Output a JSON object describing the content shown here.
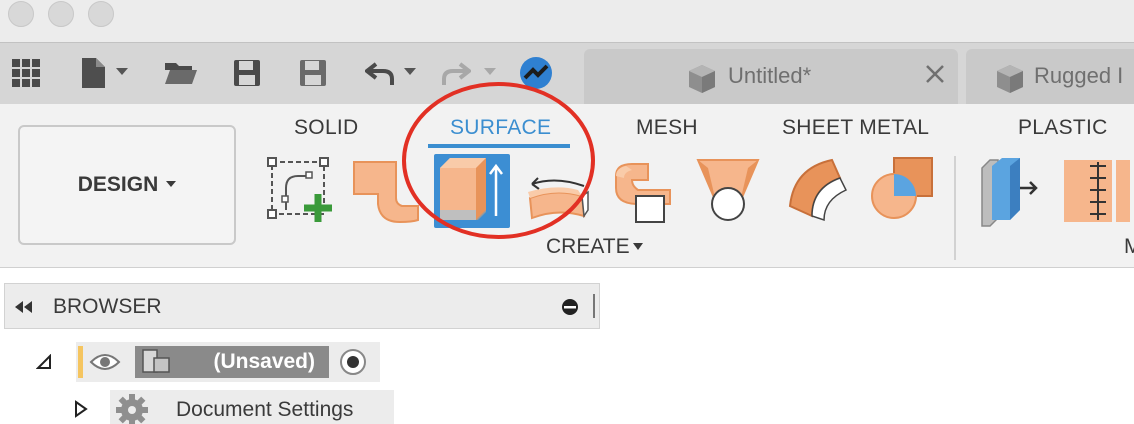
{
  "quick_access": {
    "icons": [
      "grid-icon",
      "file-icon",
      "open-folder-icon",
      "save-icon",
      "save-as-icon",
      "undo-icon",
      "redo-icon",
      "job-status-icon"
    ]
  },
  "document_tabs": [
    {
      "label": "Untitled*",
      "icon": "cube-icon"
    },
    {
      "label": "Rugged I",
      "icon": "cube-icon"
    }
  ],
  "ribbon": {
    "workspace_label": "DESIGN",
    "tabs": [
      {
        "label": "SOLID",
        "active": false
      },
      {
        "label": "SURFACE",
        "active": true
      },
      {
        "label": "MESH",
        "active": false
      },
      {
        "label": "SHEET METAL",
        "active": false
      },
      {
        "label": "PLASTIC",
        "active": false
      }
    ],
    "group_label": "CREATE",
    "next_group_label": "M",
    "tools": [
      "create-sketch-icon",
      "patch-icon",
      "extrude-icon",
      "revolve-icon",
      "sweep-icon",
      "loft-icon",
      "ruled-icon",
      "offset-icon",
      "thicken-icon",
      "split-body-icon"
    ]
  },
  "browser": {
    "title": "BROWSER",
    "root_item": "(Unsaved)",
    "items": [
      "Document Settings"
    ]
  },
  "colors": {
    "accent": "#3b8ed0",
    "highlight": "#e23024",
    "tool_orange": "#f6b68c"
  }
}
